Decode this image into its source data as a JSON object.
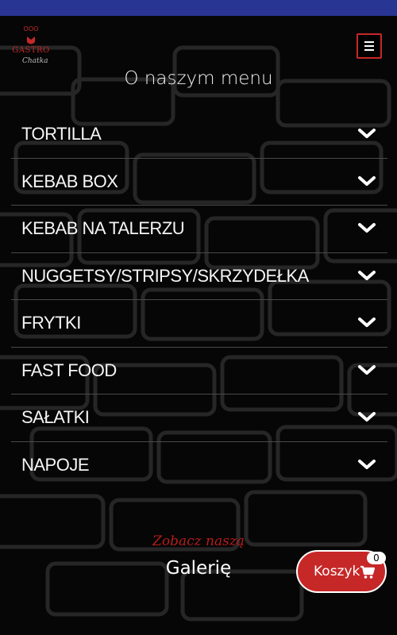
{
  "header": {
    "logo_top": "OOO",
    "logo_name": "GASTRO",
    "logo_sub": "Chatka",
    "menu_button": "hamburger-icon"
  },
  "section_title": "O naszym menu",
  "menu_categories": [
    {
      "label": "TORTILLA",
      "icon": "chevron-down-icon"
    },
    {
      "label": "KEBAB BOX",
      "icon": "chevron-down-icon"
    },
    {
      "label": "KEBAB NA TALERZU",
      "icon": "chevron-down-icon"
    },
    {
      "label": "NUGGETSY/STRIPSY/SKRZYDEŁKA",
      "icon": "chevron-down-icon"
    },
    {
      "label": "FRYTKI",
      "icon": "chevron-down-icon"
    },
    {
      "label": "FAST FOOD",
      "icon": "chevron-down-icon"
    },
    {
      "label": "SAŁATKI",
      "icon": "chevron-down-icon"
    },
    {
      "label": "NAPOJE",
      "icon": "chevron-down-icon"
    }
  ],
  "gallery": {
    "kicker": "Zobacz naszą",
    "title": "Galerię"
  },
  "cart": {
    "label": "Koszyk",
    "count": "0",
    "icon": "cart-icon"
  },
  "colors": {
    "accent": "#c62828",
    "status_bar": "#283593",
    "background": "#060606"
  }
}
